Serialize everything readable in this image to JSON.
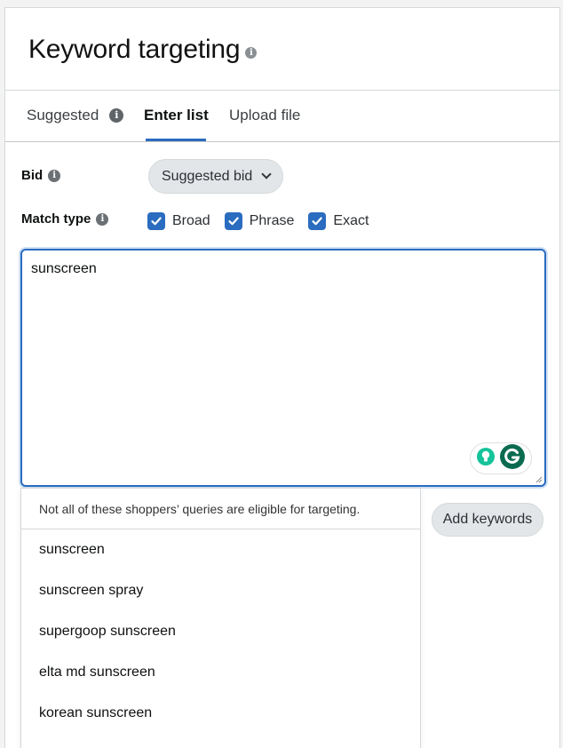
{
  "header": {
    "title": "Keyword targeting"
  },
  "tabs": [
    {
      "label": "Suggested"
    },
    {
      "label": "Enter list"
    },
    {
      "label": "Upload file"
    }
  ],
  "bid": {
    "label": "Bid",
    "selected": "Suggested bid"
  },
  "match_type": {
    "label": "Match type",
    "options": [
      {
        "label": "Broad",
        "checked": true
      },
      {
        "label": "Phrase",
        "checked": true
      },
      {
        "label": "Exact",
        "checked": true
      }
    ]
  },
  "keyword_input": {
    "value": "sunscreen"
  },
  "suggestions": {
    "note": "Not all of these shoppers’ queries are eligible for targeting.",
    "items": [
      "sunscreen",
      "sunscreen spray",
      "supergoop sunscreen",
      "elta md sunscreen",
      "korean sunscreen"
    ]
  },
  "add_keywords_label": "Add keywords",
  "colors": {
    "accent": "#2a6cbf",
    "grammarly_green": "#15c39a",
    "grammarly_dark": "#0b6b50"
  }
}
